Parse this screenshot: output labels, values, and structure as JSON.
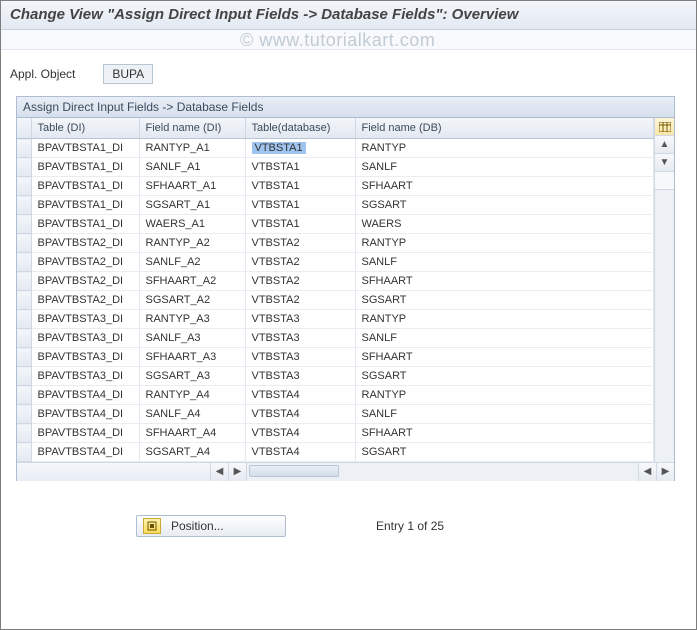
{
  "title": "Change View \"Assign Direct Input Fields -> Database Fields\": Overview",
  "watermark": "© www.tutorialkart.com",
  "appl_object": {
    "label": "Appl. Object",
    "value": "BUPA"
  },
  "grid": {
    "caption": "Assign Direct Input Fields -> Database Fields",
    "columns": [
      "Table (DI)",
      "Field name (DI)",
      "Table(database)",
      "Field name (DB)"
    ],
    "rows": [
      [
        "BPAVTBSTA1_DI",
        "RANTYP_A1",
        "VTBSTA1",
        "RANTYP"
      ],
      [
        "BPAVTBSTA1_DI",
        "SANLF_A1",
        "VTBSTA1",
        "SANLF"
      ],
      [
        "BPAVTBSTA1_DI",
        "SFHAART_A1",
        "VTBSTA1",
        "SFHAART"
      ],
      [
        "BPAVTBSTA1_DI",
        "SGSART_A1",
        "VTBSTA1",
        "SGSART"
      ],
      [
        "BPAVTBSTA1_DI",
        "WAERS_A1",
        "VTBSTA1",
        "WAERS"
      ],
      [
        "BPAVTBSTA2_DI",
        "RANTYP_A2",
        "VTBSTA2",
        "RANTYP"
      ],
      [
        "BPAVTBSTA2_DI",
        "SANLF_A2",
        "VTBSTA2",
        "SANLF"
      ],
      [
        "BPAVTBSTA2_DI",
        "SFHAART_A2",
        "VTBSTA2",
        "SFHAART"
      ],
      [
        "BPAVTBSTA2_DI",
        "SGSART_A2",
        "VTBSTA2",
        "SGSART"
      ],
      [
        "BPAVTBSTA3_DI",
        "RANTYP_A3",
        "VTBSTA3",
        "RANTYP"
      ],
      [
        "BPAVTBSTA3_DI",
        "SANLF_A3",
        "VTBSTA3",
        "SANLF"
      ],
      [
        "BPAVTBSTA3_DI",
        "SFHAART_A3",
        "VTBSTA3",
        "SFHAART"
      ],
      [
        "BPAVTBSTA3_DI",
        "SGSART_A3",
        "VTBSTA3",
        "SGSART"
      ],
      [
        "BPAVTBSTA4_DI",
        "RANTYP_A4",
        "VTBSTA4",
        "RANTYP"
      ],
      [
        "BPAVTBSTA4_DI",
        "SANLF_A4",
        "VTBSTA4",
        "SANLF"
      ],
      [
        "BPAVTBSTA4_DI",
        "SFHAART_A4",
        "VTBSTA4",
        "SFHAART"
      ],
      [
        "BPAVTBSTA4_DI",
        "SGSART_A4",
        "VTBSTA4",
        "SGSART"
      ]
    ],
    "selected_cell": {
      "row": 0,
      "col": 2
    }
  },
  "footer": {
    "position_label": "Position...",
    "entry_text": "Entry 1 of 25"
  }
}
